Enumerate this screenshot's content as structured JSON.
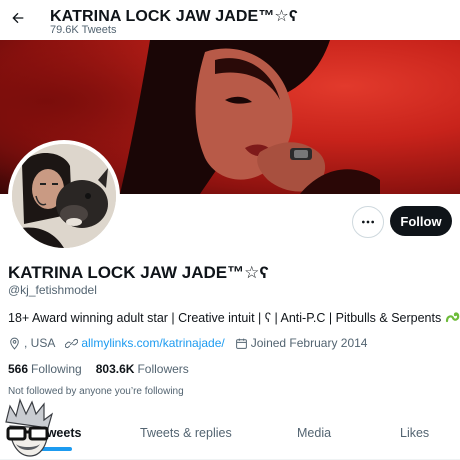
{
  "header": {
    "title": "KATRINA LOCK JAW JADE™☆ʕ",
    "tweet_count": "79.6K Tweets"
  },
  "profile": {
    "display_name": "KATRINA LOCK JAW JADE™☆ʕ",
    "handle": "@kj_fetishmodel",
    "bio": "18+ Award winning adult star | Creative intuit | ʕ | Anti-P.C | Pitbulls & Serpents",
    "location": ", USA",
    "website": "allmylinks.com/katrinajade/",
    "joined": "Joined February 2014",
    "following_count": "566",
    "following_label": "Following",
    "followers_count": "803.6K",
    "followers_label": "Followers",
    "followed_by_note": "Not followed by anyone you’re following"
  },
  "actions": {
    "follow_label": "Follow"
  },
  "tabs": [
    {
      "label": "Tweets"
    },
    {
      "label": "Tweets & replies"
    },
    {
      "label": "Media"
    },
    {
      "label": "Likes"
    }
  ],
  "colors": {
    "accent": "#1d9bf0",
    "banner_red": "#c8231b",
    "text_primary": "#0f1419",
    "text_secondary": "#536471"
  },
  "icons": [
    "back-arrow-icon",
    "more-dots-icon",
    "location-icon",
    "link-icon",
    "calendar-icon",
    "snake-emoji-icon"
  ]
}
